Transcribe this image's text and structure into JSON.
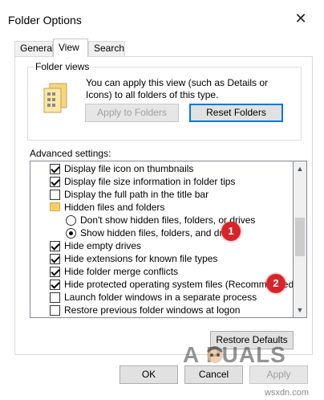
{
  "window": {
    "title": "Folder Options",
    "close_glyph": "✕"
  },
  "tabs": [
    "General",
    "View",
    "Search"
  ],
  "folder_views": {
    "group_label": "Folder views",
    "description": "You can apply this view (such as Details or Icons) to all folders of this type.",
    "apply_button": "Apply to Folders",
    "reset_button": "Reset Folders"
  },
  "advanced": {
    "label": "Advanced settings:",
    "items": [
      {
        "type": "checkbox",
        "checked": true,
        "label": "Display file icon on thumbnails"
      },
      {
        "type": "checkbox",
        "checked": true,
        "label": "Display file size information in folder tips"
      },
      {
        "type": "checkbox",
        "checked": false,
        "label": "Display the full path in the title bar"
      },
      {
        "type": "folder",
        "checked": false,
        "label": "Hidden files and folders"
      },
      {
        "type": "radio",
        "checked": false,
        "label": "Don't show hidden files, folders, or drives"
      },
      {
        "type": "radio",
        "checked": true,
        "label": "Show hidden files, folders, and drives"
      },
      {
        "type": "checkbox",
        "checked": true,
        "label": "Hide empty drives"
      },
      {
        "type": "checkbox",
        "checked": true,
        "label": "Hide extensions for known file types"
      },
      {
        "type": "checkbox",
        "checked": true,
        "label": "Hide folder merge conflicts"
      },
      {
        "type": "checkbox",
        "checked": true,
        "label": "Hide protected operating system files (Recommended)"
      },
      {
        "type": "checkbox",
        "checked": false,
        "label": "Launch folder windows in a separate process"
      },
      {
        "type": "checkbox",
        "checked": false,
        "label": "Restore previous folder windows at logon"
      }
    ],
    "restore_button": "Restore Defaults"
  },
  "annotations": {
    "first": "1",
    "second": "2"
  },
  "footer": {
    "ok": "OK",
    "cancel": "Cancel",
    "apply": "Apply"
  },
  "watermark": {
    "brand": "A  PUALS",
    "site": "wsxdn.com"
  },
  "colors": {
    "accent": "#0078d7",
    "badge": "#d8232a"
  }
}
